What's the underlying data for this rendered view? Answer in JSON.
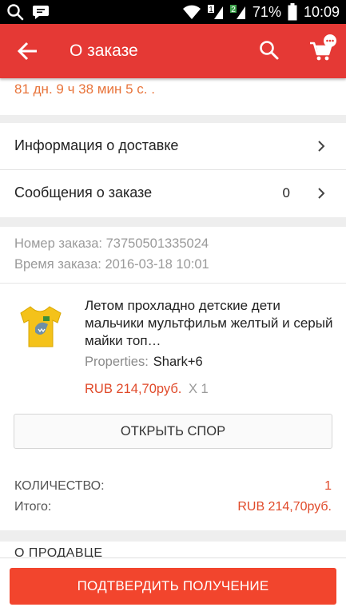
{
  "status_bar": {
    "battery": "71%",
    "time": "10:09",
    "left_icons": [
      "search-icon",
      "chat-icon"
    ],
    "right_icons": [
      "wifi-icon",
      "signal-icon",
      "signal-icon",
      "battery-icon"
    ]
  },
  "app_bar": {
    "title": "О заказе",
    "icons": [
      "back-arrow-icon",
      "search-icon",
      "cart-icon"
    ],
    "color": "#e53935"
  },
  "countdown": {
    "text": "81 дн. 9 ч 38 мин 5 с. ."
  },
  "nav": {
    "delivery_label": "Информация о доставке",
    "messages_label": "Сообщения о заказе",
    "messages_count": "0"
  },
  "order": {
    "number_text": "Номер заказа: 73750501335024",
    "time_text": "Время заказа: 2016-03-18 10:01"
  },
  "product": {
    "title": "Летом прохладно детские дети мальчики мультфильм желтый и серый майки топ…",
    "properties_label": "Properties:",
    "properties_value": "Shark+6",
    "price": "RUB 214,70руб.",
    "qty": "X 1",
    "thumb_icon": "tshirt-icon"
  },
  "dispute_button": "ОТКРЫТЬ СПОР",
  "summary": {
    "quantity_label": "КОЛИЧЕСТВО:",
    "quantity_value": "1",
    "total_label": "Итого:",
    "total_value": "RUB 214,70руб."
  },
  "seller_section_label": "О ПРОДАВЦЕ",
  "confirm_button": "ПОДТВЕРДИТЬ ПОЛУЧЕНИЕ",
  "colors": {
    "accent": "#f2452d",
    "price": "#e04a2a",
    "countdown": "#e8743b"
  }
}
